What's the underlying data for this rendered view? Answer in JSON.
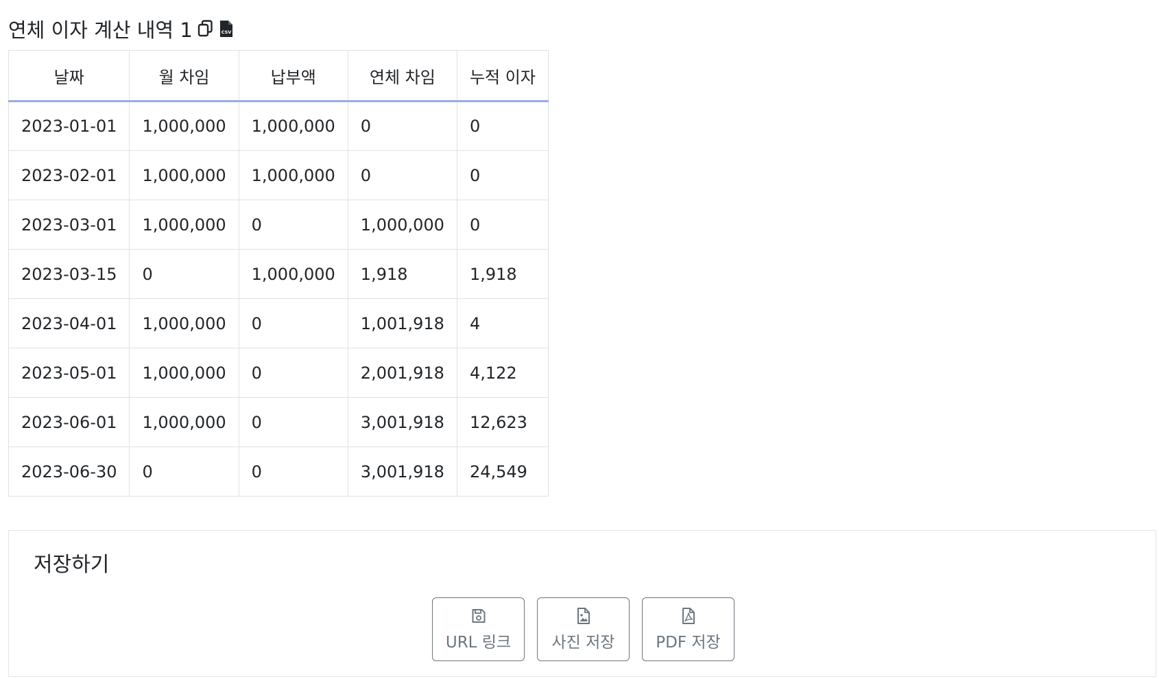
{
  "page": {
    "title": "연체 이자 계산 내역 1",
    "copy_icon": "copy-icon",
    "csv_icon": "csv-file-icon"
  },
  "table": {
    "headers": [
      "날짜",
      "월 차임",
      "납부액",
      "연체 차임",
      "누적 이자"
    ],
    "rows": [
      [
        "2023-01-01",
        "1,000,000",
        "1,000,000",
        "0",
        "0"
      ],
      [
        "2023-02-01",
        "1,000,000",
        "1,000,000",
        "0",
        "0"
      ],
      [
        "2023-03-01",
        "1,000,000",
        "0",
        "1,000,000",
        "0"
      ],
      [
        "2023-03-15",
        "0",
        "1,000,000",
        "1,918",
        "1,918"
      ],
      [
        "2023-04-01",
        "1,000,000",
        "0",
        "1,001,918",
        "4"
      ],
      [
        "2023-05-01",
        "1,000,000",
        "0",
        "2,001,918",
        "4,122"
      ],
      [
        "2023-06-01",
        "1,000,000",
        "0",
        "3,001,918",
        "12,623"
      ],
      [
        "2023-06-30",
        "0",
        "0",
        "3,001,918",
        "24,549"
      ]
    ]
  },
  "save": {
    "title": "저장하기",
    "buttons": [
      {
        "label": "URL 링크",
        "icon": "floppy-disk-icon"
      },
      {
        "label": "사진 저장",
        "icon": "image-file-icon"
      },
      {
        "label": "PDF 저장",
        "icon": "pdf-file-icon"
      }
    ]
  },
  "colors": {
    "text": "#212529",
    "border": "#dee2e6",
    "header_underline": "#9aa9e6",
    "button_gray": "#6c757d"
  }
}
